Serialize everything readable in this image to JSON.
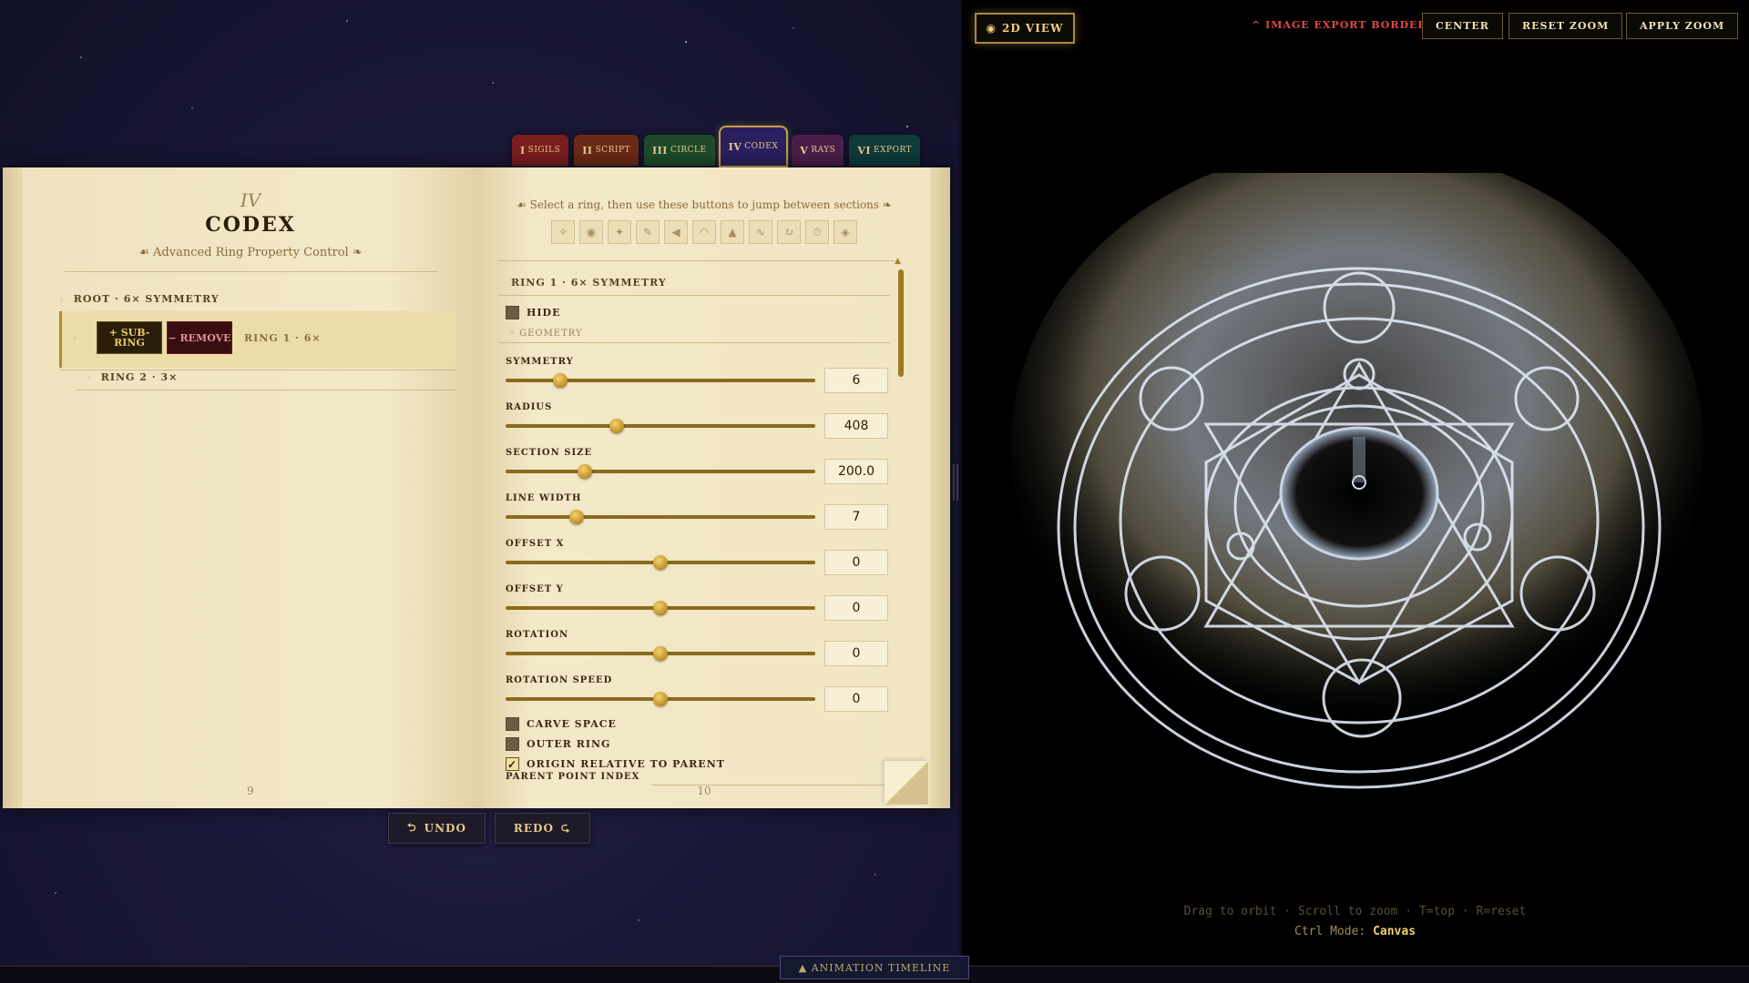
{
  "tabs": [
    {
      "num": "I",
      "label": "SIGILS",
      "color": "#7a1e1e"
    },
    {
      "num": "II",
      "label": "SCRIPT",
      "color": "#6a2a18"
    },
    {
      "num": "III",
      "label": "CIRCLE",
      "color": "#1e4a2a"
    },
    {
      "num": "IV",
      "label": "CODEX",
      "color": "#2a2060",
      "active": true
    },
    {
      "num": "V",
      "label": "RAYS",
      "color": "#4a1e4a"
    },
    {
      "num": "VI",
      "label": "EXPORT",
      "color": "#0e3a3a"
    }
  ],
  "left_page": {
    "chapter_num": "IV",
    "title": "CODEX",
    "subtitle": "☙ Advanced Ring Property Control ❧",
    "tree": {
      "root_label": "ROOT · 6× SYMMETRY",
      "sub_ring_btn": "+ SUB-RING",
      "remove_btn": "− REMOVE",
      "ring1_label": "RING 1 · 6×",
      "ring2_label": "RING 2 · 3×"
    },
    "page_number": "9"
  },
  "right_page": {
    "hint": "☙ Select a ring, then use these buttons to jump between sections ❧",
    "nav_icons": [
      "✧",
      "◉",
      "✦",
      "✎",
      "◀",
      "◠",
      "▲",
      "∿",
      "↻",
      "⏱",
      "◈"
    ],
    "section_title": "RING 1 · 6× SYMMETRY",
    "hide_label": "HIDE",
    "geometry_label": "◦ GEOMETRY",
    "controls": [
      {
        "label": "SYMMETRY",
        "value": "6",
        "fraction": 0.175
      },
      {
        "label": "RADIUS",
        "value": "408",
        "fraction": 0.36
      },
      {
        "label": "SECTION SIZE",
        "value": "200.0",
        "fraction": 0.255
      },
      {
        "label": "LINE WIDTH",
        "value": "7",
        "fraction": 0.23
      },
      {
        "label": "OFFSET X",
        "value": "0",
        "fraction": 0.5
      },
      {
        "label": "OFFSET Y",
        "value": "0",
        "fraction": 0.5
      },
      {
        "label": "ROTATION",
        "value": "0",
        "fraction": 0.5
      },
      {
        "label": "ROTATION SPEED",
        "value": "0",
        "fraction": 0.5
      }
    ],
    "checkboxes": [
      {
        "label": "CARVE SPACE",
        "checked": false
      },
      {
        "label": "OUTER RING",
        "checked": false
      },
      {
        "label": "ORIGIN RELATIVE TO PARENT",
        "checked": true
      }
    ],
    "parent_point_label": "PARENT POINT INDEX",
    "page_number": "10"
  },
  "undo_label": "UNDO",
  "redo_label": "REDO",
  "timeline_label": "▲ ANIMATION TIMELINE",
  "viewport": {
    "view_btn": "2D VIEW",
    "export_border": "^ IMAGE EXPORT BORDER",
    "center_btn": "CENTER",
    "reset_zoom_btn": "RESET ZOOM",
    "apply_zoom_btn": "APPLY ZOOM",
    "help_text": "Drag to orbit · Scroll to zoom · T=top · R=reset",
    "mode_prefix": "Ctrl Mode:",
    "mode_value": "Canvas"
  }
}
